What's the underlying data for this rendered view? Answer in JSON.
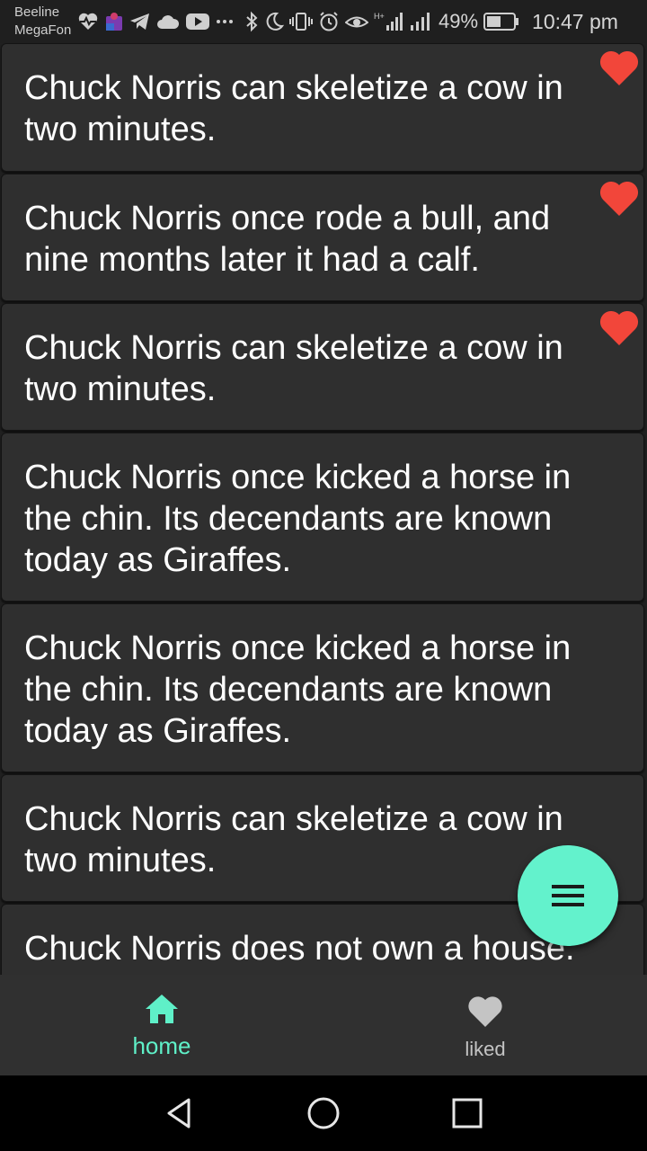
{
  "status_bar": {
    "carrier_1": "Beeline",
    "carrier_2": "MegaFon",
    "battery_percent": "49%",
    "battery_level": 0.49,
    "time": "10:47 pm",
    "left_icons": [
      "heart-pulse-icon",
      "puzzle-icon",
      "telegram-icon",
      "cloud-icon",
      "youtube-icon",
      "more-icon"
    ],
    "right_icons": [
      "bluetooth-icon",
      "moon-icon",
      "vibrate-icon",
      "alarm-icon",
      "eye-icon",
      "signal-h-plus-icon",
      "signal-icon",
      "battery-icon"
    ]
  },
  "jokes": [
    {
      "text": "Chuck Norris can skeletize a cow in two minutes.",
      "liked": true
    },
    {
      "text": "Chuck Norris once rode a bull, and nine months later it had a calf.",
      "liked": true
    },
    {
      "text": "Chuck Norris can skeletize a cow in two minutes.",
      "liked": true
    },
    {
      "text": "Chuck Norris once kicked a horse in the chin. Its decendants are known today as Giraffes.",
      "liked": false
    },
    {
      "text": "Chuck Norris once kicked a horse in the chin. Its decendants are known today as Giraffes.",
      "liked": false
    },
    {
      "text": "Chuck Norris can skeletize a cow in two minutes.",
      "liked": false
    },
    {
      "text": "Chuck Norris does not own a house.",
      "liked": false
    }
  ],
  "fab": {
    "icon": "menu-icon"
  },
  "bottom_nav": {
    "items": [
      {
        "label": "home",
        "icon": "home-icon",
        "active": true
      },
      {
        "label": "liked",
        "icon": "heart-icon",
        "active": false
      }
    ]
  },
  "system_nav": {
    "icons": [
      "back-icon",
      "home-circle-icon",
      "recents-icon"
    ]
  },
  "colors": {
    "accent": "#63f2cc",
    "heart": "#f2463a",
    "card": "#2f2f2f",
    "background": "#202020",
    "nav_bar": "#303030"
  }
}
